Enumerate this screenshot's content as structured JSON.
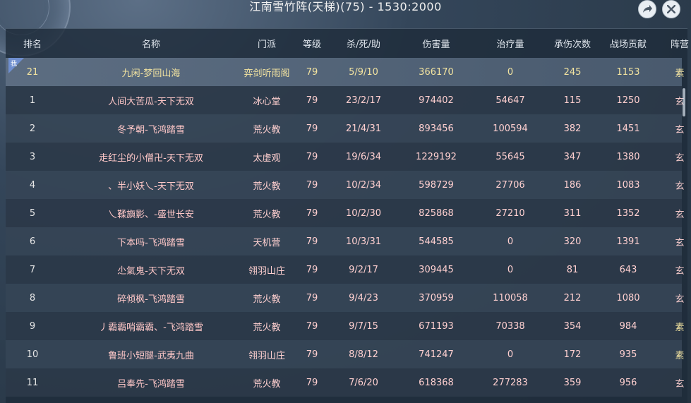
{
  "window": {
    "title": "江南雪竹阵(天梯)(75) - 1530:2000"
  },
  "header": {
    "columns": [
      "排名",
      "名称",
      "门派",
      "等级",
      "杀/死/助",
      "伤害量",
      "治疗量",
      "承伤次数",
      "战场贡献",
      "阵营"
    ]
  },
  "self_badge": "我",
  "rows": [
    {
      "rank": "21",
      "name": "九闲-梦回山海",
      "school": "弈剑听雨阁",
      "level": "79",
      "kda": "5/9/10",
      "damage": "366170",
      "heal": "0",
      "hits": "245",
      "contrib": "1153",
      "camp": "素",
      "self": true
    },
    {
      "rank": "1",
      "name": "人间大苦瓜-天下无双",
      "school": "冰心堂",
      "level": "79",
      "kda": "23/2/17",
      "damage": "974402",
      "heal": "54647",
      "hits": "115",
      "contrib": "1250",
      "camp": "玄"
    },
    {
      "rank": "2",
      "name": "冬予朝-飞鸿踏雪",
      "school": "荒火教",
      "level": "79",
      "kda": "21/4/31",
      "damage": "893456",
      "heal": "100594",
      "hits": "382",
      "contrib": "1451",
      "camp": "玄"
    },
    {
      "rank": "3",
      "name": "走红尘的小僧卍-天下无双",
      "school": "太虚观",
      "level": "79",
      "kda": "19/6/34",
      "damage": "1229192",
      "heal": "55645",
      "hits": "347",
      "contrib": "1380",
      "camp": "玄"
    },
    {
      "rank": "4",
      "name": "、半小妖乀-天下无双",
      "school": "荒火教",
      "level": "79",
      "kda": "10/2/34",
      "damage": "598729",
      "heal": "27706",
      "hits": "186",
      "contrib": "1083",
      "camp": "玄"
    },
    {
      "rank": "5",
      "name": "乀鞣旟影、-盛世长安",
      "school": "荒火教",
      "level": "79",
      "kda": "10/2/30",
      "damage": "825868",
      "heal": "27210",
      "hits": "311",
      "contrib": "1352",
      "camp": "玄"
    },
    {
      "rank": "6",
      "name": "下本吗-飞鸿踏雪",
      "school": "天机营",
      "level": "79",
      "kda": "10/3/31",
      "damage": "544585",
      "heal": "0",
      "hits": "320",
      "contrib": "1391",
      "camp": "玄"
    },
    {
      "rank": "7",
      "name": "尐氣鬼-天下无双",
      "school": "翎羽山庄",
      "level": "79",
      "kda": "9/2/17",
      "damage": "309445",
      "heal": "0",
      "hits": "81",
      "contrib": "643",
      "camp": "玄"
    },
    {
      "rank": "8",
      "name": "碎倾枫-飞鸿踏雪",
      "school": "荒火教",
      "level": "79",
      "kda": "9/4/23",
      "damage": "370959",
      "heal": "110058",
      "hits": "212",
      "contrib": "1080",
      "camp": "玄"
    },
    {
      "rank": "9",
      "name": "丿霸霸哨霸霸、-飞鸿踏雪",
      "school": "荒火教",
      "level": "79",
      "kda": "9/7/15",
      "damage": "671193",
      "heal": "70338",
      "hits": "354",
      "contrib": "984",
      "camp": "素"
    },
    {
      "rank": "10",
      "name": "鲁班小短腿-武夷九曲",
      "school": "翎羽山庄",
      "level": "79",
      "kda": "8/8/12",
      "damage": "741247",
      "heal": "0",
      "hits": "172",
      "contrib": "935",
      "camp": "素"
    },
    {
      "rank": "11",
      "name": "吕奉先-飞鸿踏雪",
      "school": "荒火教",
      "level": "79",
      "kda": "7/6/20",
      "damage": "618368",
      "heal": "277283",
      "hits": "359",
      "contrib": "956",
      "camp": "玄"
    }
  ],
  "icons": {
    "share": "share-icon",
    "close": "close-icon"
  }
}
